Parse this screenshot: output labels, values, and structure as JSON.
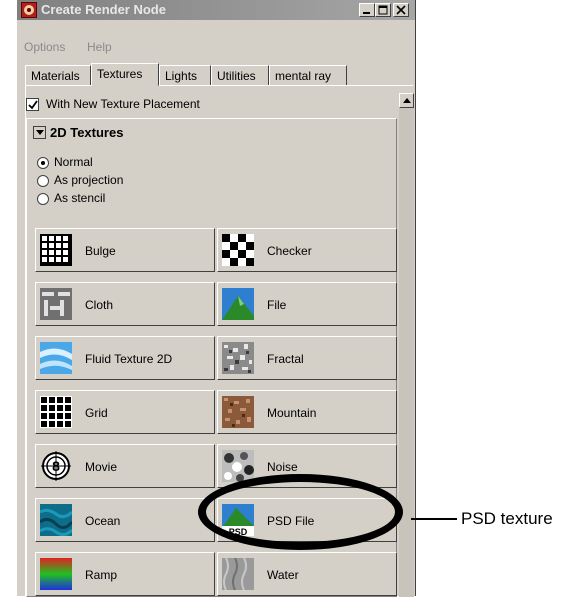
{
  "window": {
    "title": "Create Render Node",
    "controls": {
      "minimize": "minimize-icon",
      "maximize": "maximize-icon",
      "close": "close-icon"
    }
  },
  "menu": {
    "items": [
      "Options",
      "Help"
    ]
  },
  "tabs": [
    {
      "label": "Materials",
      "active": false
    },
    {
      "label": "Textures",
      "active": true
    },
    {
      "label": "Lights",
      "active": false
    },
    {
      "label": "Utilities",
      "active": false
    },
    {
      "label": "mental ray",
      "active": false
    }
  ],
  "options": {
    "new_texture_placement": {
      "label": "With New Texture Placement",
      "checked": true
    }
  },
  "section": {
    "title": "2D Textures",
    "expanded": true,
    "placement_modes": [
      {
        "label": "Normal",
        "selected": true
      },
      {
        "label": "As projection",
        "selected": false
      },
      {
        "label": "As stencil",
        "selected": false
      }
    ]
  },
  "textures": [
    {
      "label": "Bulge",
      "icon": "bulge-texture-icon"
    },
    {
      "label": "Checker",
      "icon": "checker-texture-icon"
    },
    {
      "label": "Cloth",
      "icon": "cloth-texture-icon"
    },
    {
      "label": "File",
      "icon": "file-texture-icon"
    },
    {
      "label": "Fluid Texture 2D",
      "icon": "fluid-texture-icon"
    },
    {
      "label": "Fractal",
      "icon": "fractal-texture-icon"
    },
    {
      "label": "Grid",
      "icon": "grid-texture-icon"
    },
    {
      "label": "Mountain",
      "icon": "mountain-texture-icon"
    },
    {
      "label": "Movie",
      "icon": "movie-texture-icon"
    },
    {
      "label": "Noise",
      "icon": "noise-texture-icon"
    },
    {
      "label": "Ocean",
      "icon": "ocean-texture-icon"
    },
    {
      "label": "PSD File",
      "icon": "psd-file-texture-icon",
      "icon_text": "PSD"
    },
    {
      "label": "Ramp",
      "icon": "ramp-texture-icon"
    },
    {
      "label": "Water",
      "icon": "water-texture-icon"
    }
  ],
  "callout": {
    "label": "PSD texture"
  },
  "colors": {
    "dialog_bg": "#d4d0c8",
    "title_inactive": "#a6a6a6",
    "highlight": "#000000"
  }
}
